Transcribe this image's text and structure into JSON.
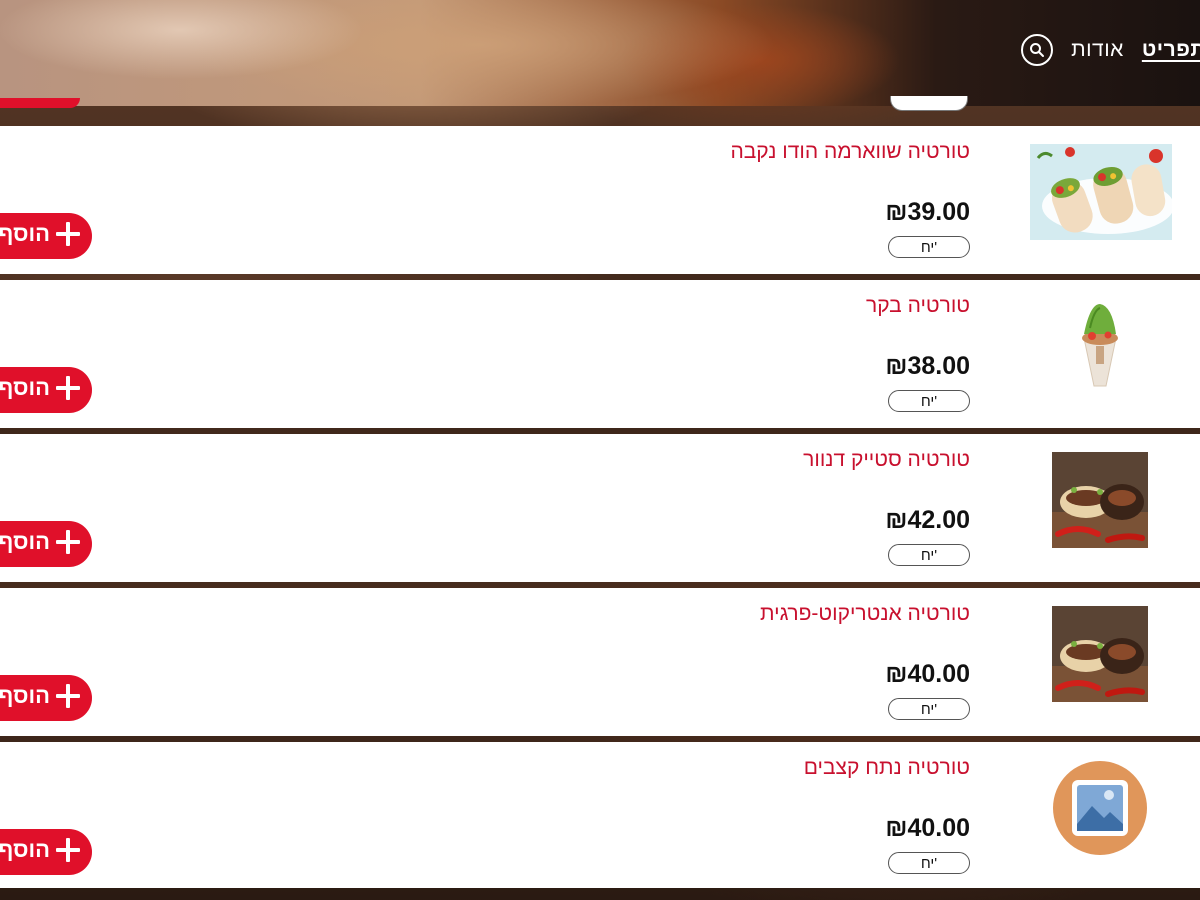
{
  "header": {
    "nav_items": [
      {
        "label": "תפריט",
        "active": true
      },
      {
        "label": "אודות",
        "active": false
      }
    ]
  },
  "products": [
    {
      "name": "טורטיה שווארמה הודו נקבה",
      "price": "₪39.00",
      "unit": "יח'",
      "add_label": "הוסף",
      "image": "wraps-photo"
    },
    {
      "name": "טורטיה בקר",
      "price": "₪38.00",
      "unit": "יח'",
      "add_label": "הוסף",
      "image": "wrap-cone-photo"
    },
    {
      "name": "טורטיה סטייק דנוור",
      "price": "₪42.00",
      "unit": "יח'",
      "add_label": "הוסף",
      "image": "steak-wrap-photo"
    },
    {
      "name": "טורטיה אנטריקוט-פרגית",
      "price": "₪40.00",
      "unit": "יח'",
      "add_label": "הוסף",
      "image": "steak-wrap-photo"
    },
    {
      "name": "טורטיה נתח קצבים",
      "price": "₪40.00",
      "unit": "יח'",
      "add_label": "הוסף",
      "image": "image-placeholder-icon"
    }
  ],
  "colors": {
    "accent_red": "#e0102a",
    "title_red": "#c8102e",
    "placeholder_circle": "#e0965a"
  }
}
